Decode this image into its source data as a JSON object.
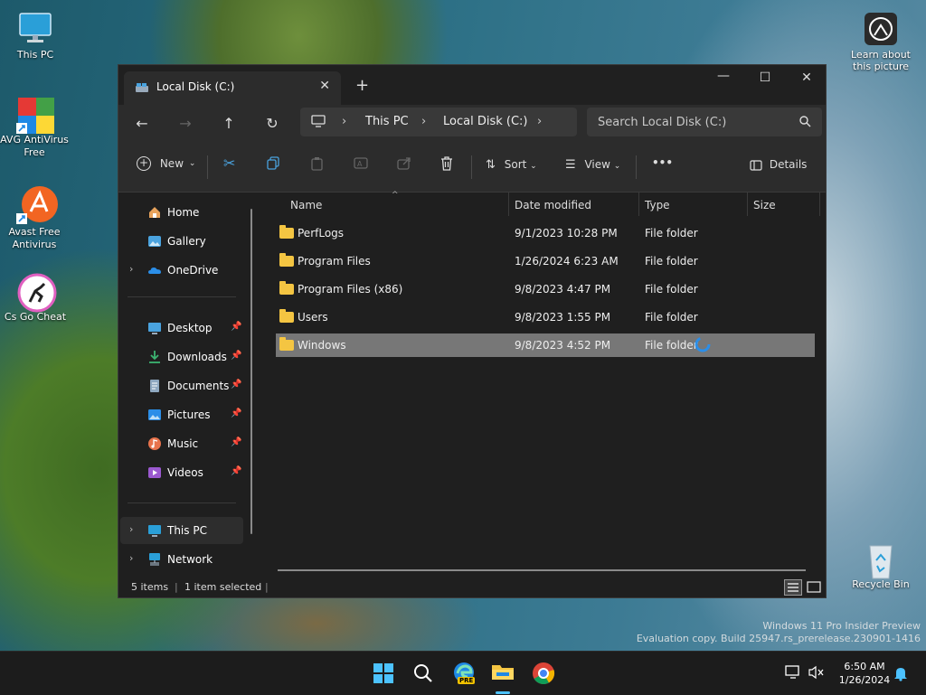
{
  "desktop": {
    "icons": [
      {
        "label": "This PC"
      },
      {
        "label": "AVG AntiVirus Free"
      },
      {
        "label": "Avast Free Antivirus"
      },
      {
        "label": "Cs Go Cheat"
      },
      {
        "label": "Learn about this picture"
      },
      {
        "label": "Recycle Bin"
      }
    ],
    "watermark_line1": "Windows 11 Pro Insider Preview",
    "watermark_line2": "Evaluation copy. Build 25947.rs_prerelease.230901-1416"
  },
  "window": {
    "tab_title": "Local Disk (C:)",
    "tab_close": "✕",
    "new_tab": "+",
    "minimize": "—",
    "maximize": "☐",
    "close": "✕"
  },
  "address": {
    "crumbs": [
      "This PC",
      "Local Disk (C:)"
    ],
    "search_placeholder": "Search Local Disk (C:)"
  },
  "toolbar": {
    "new_label": "New",
    "sort_label": "Sort",
    "view_label": "View",
    "more_label": "•••",
    "details_label": "Details"
  },
  "nav": {
    "items": [
      {
        "label": "Home",
        "icon": "home-icon"
      },
      {
        "label": "Gallery",
        "icon": "gallery-icon"
      },
      {
        "label": "OneDrive",
        "icon": "onedrive-icon"
      },
      {
        "label": "Desktop",
        "icon": "desktop-icon"
      },
      {
        "label": "Downloads",
        "icon": "downloads-icon"
      },
      {
        "label": "Documents",
        "icon": "documents-icon"
      },
      {
        "label": "Pictures",
        "icon": "pictures-icon"
      },
      {
        "label": "Music",
        "icon": "music-icon"
      },
      {
        "label": "Videos",
        "icon": "videos-icon"
      },
      {
        "label": "This PC",
        "icon": "this-pc-icon"
      },
      {
        "label": "Network",
        "icon": "network-icon"
      }
    ]
  },
  "table": {
    "columns": [
      "Name",
      "Date modified",
      "Type",
      "Size"
    ],
    "rows": [
      {
        "name": "PerfLogs",
        "date": "9/1/2023 10:28 PM",
        "type": "File folder",
        "size": ""
      },
      {
        "name": "Program Files",
        "date": "1/26/2024 6:23 AM",
        "type": "File folder",
        "size": ""
      },
      {
        "name": "Program Files (x86)",
        "date": "9/8/2023 4:47 PM",
        "type": "File folder",
        "size": ""
      },
      {
        "name": "Users",
        "date": "9/8/2023 1:55 PM",
        "type": "File folder",
        "size": ""
      },
      {
        "name": "Windows",
        "date": "9/8/2023 4:52 PM",
        "type": "File folder",
        "size": ""
      }
    ]
  },
  "status": {
    "items_count": "5 items",
    "selection": "1 item selected"
  },
  "taskbar": {
    "time": "6:50 AM",
    "date": "1/26/2024",
    "edge_badge": "PRE"
  }
}
